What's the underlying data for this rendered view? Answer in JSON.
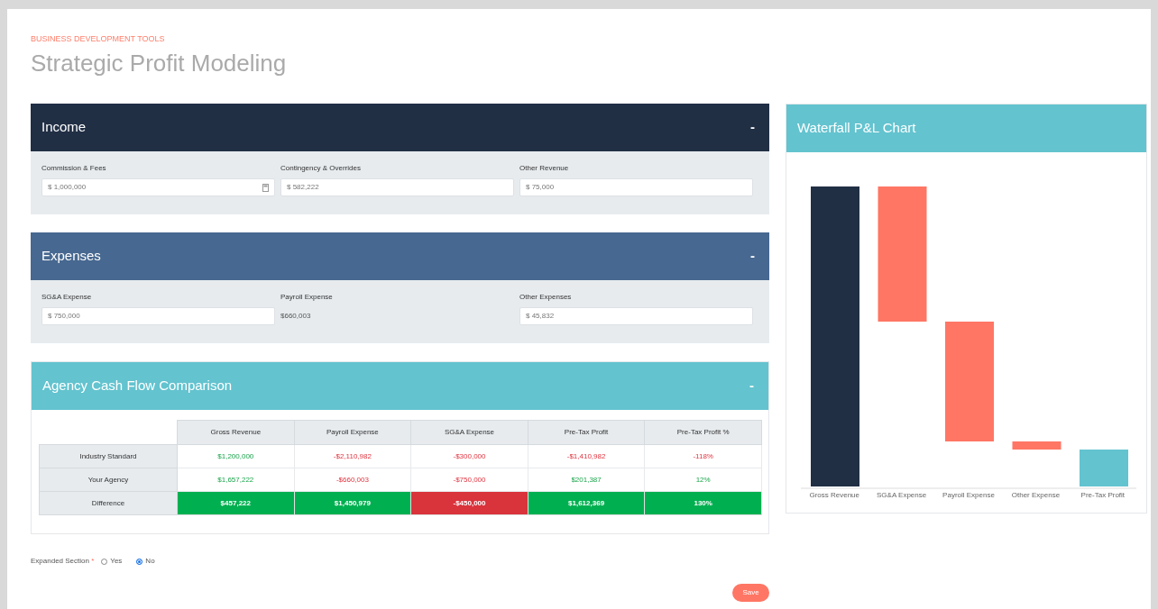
{
  "eyebrow": "BUSINESS DEVELOPMENT TOOLS",
  "title": "Strategic Profit Modeling",
  "sections": [
    {
      "title": "Income",
      "kind": "dark",
      "collapse": "-",
      "fields": [
        {
          "label": "Commission & Fees",
          "kind": "input-icon",
          "value": "$ 1,000,000"
        },
        {
          "label": "Contingency & Overrides",
          "kind": "input",
          "value": "$ 582,222"
        },
        {
          "label": "Other Revenue",
          "kind": "input",
          "value": "$ 75,000"
        }
      ]
    },
    {
      "title": "Expenses",
      "kind": "mid",
      "collapse": "-",
      "fields": [
        {
          "label": "SG&A Expense",
          "kind": "input",
          "value": "$ 750,000"
        },
        {
          "label": "Payroll Expense",
          "kind": "readonly",
          "value": "$660,003"
        },
        {
          "label": "Other Expenses",
          "kind": "input",
          "value": "$ 45,832"
        }
      ]
    }
  ],
  "comparison": {
    "title": "Agency Cash Flow Comparison",
    "collapse": "-",
    "columns": [
      "Gross Revenue",
      "Payroll Expense",
      "SG&A Expense",
      "Pre-Tax Profit",
      "Pre-Tax Profit %"
    ],
    "rows": [
      {
        "label": "Industry Standard",
        "kind": "plain",
        "cells": [
          {
            "text": "$1,200,000",
            "negative": false
          },
          {
            "text": "-$2,110,982",
            "negative": true
          },
          {
            "text": "-$300,000",
            "negative": true
          },
          {
            "text": "-$1,410,982",
            "negative": true
          },
          {
            "text": "-118%",
            "negative": true
          }
        ]
      },
      {
        "label": "Your Agency",
        "kind": "plain",
        "cells": [
          {
            "text": "$1,657,222",
            "negative": false
          },
          {
            "text": "-$660,003",
            "negative": true
          },
          {
            "text": "-$750,000",
            "negative": true
          },
          {
            "text": "$201,387",
            "negative": false
          },
          {
            "text": "12%",
            "negative": false
          }
        ]
      },
      {
        "label": "Difference",
        "kind": "filled",
        "cells": [
          {
            "text": "$457,222",
            "negative": false
          },
          {
            "text": "$1,450,979",
            "negative": false
          },
          {
            "text": "-$450,000",
            "negative": true
          },
          {
            "text": "$1,612,369",
            "negative": false
          },
          {
            "text": "130%",
            "negative": false
          }
        ]
      }
    ]
  },
  "expanded_section": {
    "label": "Expanded Section",
    "required_mark": "*",
    "options": [
      {
        "label": "Yes",
        "selected": false
      },
      {
        "label": "No",
        "selected": true
      }
    ]
  },
  "save_button": "Save",
  "waterfall": {
    "title": "Waterfall P&L Chart",
    "bars": [
      {
        "label": "Gross Revenue",
        "kind": "total"
      },
      {
        "label": "SG&A Expense",
        "kind": "decrease"
      },
      {
        "label": "Payroll Expense",
        "kind": "decrease"
      },
      {
        "label": "Other Expense",
        "kind": "decrease"
      },
      {
        "label": "Pre-Tax Profit",
        "kind": "result"
      }
    ]
  }
}
